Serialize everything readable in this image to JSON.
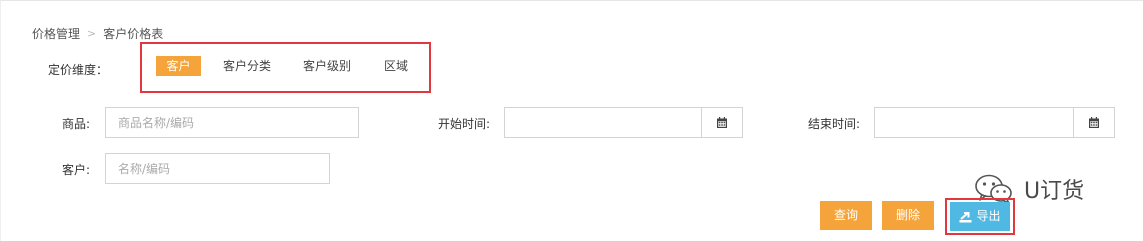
{
  "breadcrumb": {
    "parent": "价格管理",
    "separator": ">",
    "current": "客户价格表"
  },
  "dimension": {
    "label": "定价维度：",
    "tabs": [
      {
        "label": "客户",
        "active": true
      },
      {
        "label": "客户分类",
        "active": false
      },
      {
        "label": "客户级别",
        "active": false
      },
      {
        "label": "区域",
        "active": false
      }
    ]
  },
  "filters": {
    "product": {
      "label": "商品:",
      "value": "",
      "placeholder": "商品名称/编码"
    },
    "start_time": {
      "label": "开始时间:",
      "value": ""
    },
    "end_time": {
      "label": "结束时间:",
      "value": ""
    },
    "customer": {
      "label": "客户:",
      "value": "",
      "placeholder": "名称/编码"
    }
  },
  "actions": {
    "query_label": "查询",
    "delete_label": "删除",
    "export_label": "导出"
  },
  "watermark": {
    "text": "U订货",
    "icon": "wechat-icon"
  },
  "colors": {
    "accent_orange": "#f5a43b",
    "export_blue": "#4fb8e3",
    "highlight_red": "#e0383e"
  }
}
